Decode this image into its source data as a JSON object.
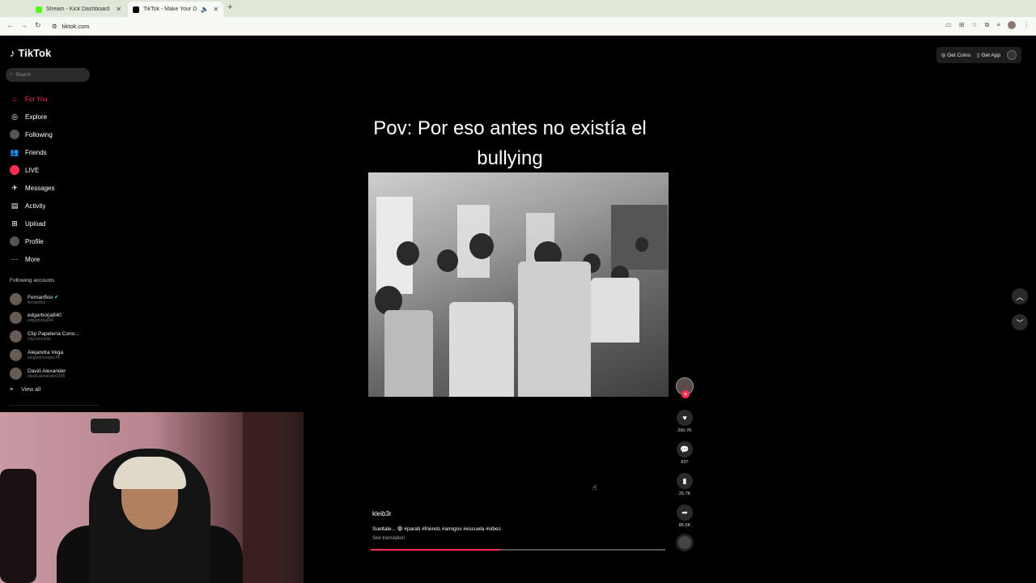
{
  "browser": {
    "tabs": [
      {
        "title": "Stream - Kick Dashboard",
        "active": false,
        "favicon_color": "#53fc18"
      },
      {
        "title": "TikTok - Make Your Day",
        "active": true,
        "favicon_color": "#000000"
      }
    ],
    "url": "tiktok.com"
  },
  "app": {
    "logo": "TikTok",
    "search_placeholder": "Search"
  },
  "nav": [
    {
      "label": "For You",
      "icon": "home-icon",
      "active": true
    },
    {
      "label": "Explore",
      "icon": "compass-icon",
      "active": false
    },
    {
      "label": "Following",
      "icon": "avatar-icon",
      "active": false
    },
    {
      "label": "Friends",
      "icon": "people-icon",
      "active": false
    },
    {
      "label": "LIVE",
      "icon": "live-icon",
      "active": false
    },
    {
      "label": "Messages",
      "icon": "messages-icon",
      "active": false
    },
    {
      "label": "Activity",
      "icon": "activity-icon",
      "active": false
    },
    {
      "label": "Upload",
      "icon": "upload-icon",
      "active": false
    },
    {
      "label": "Profile",
      "icon": "profile-icon",
      "active": false
    },
    {
      "label": "More",
      "icon": "more-icon",
      "active": false
    }
  ],
  "following_accounts": {
    "title": "Following accounts",
    "accounts": [
      {
        "name": "Fernanfloo",
        "handle": "fernanfloo",
        "verified": true
      },
      {
        "name": "edgarborja840",
        "handle": "edgarborja840",
        "verified": false
      },
      {
        "name": "Clip Papelería Cono...",
        "handle": "clip.conocoto",
        "verified": false
      },
      {
        "name": "Alejandra Vega",
        "handle": "alejandravega144",
        "verified": false
      },
      {
        "name": "David Alexander",
        "handle": "david.alexander1045",
        "verified": false
      }
    ],
    "view_all": "View all"
  },
  "topbar": {
    "get_coins": "Get Coins",
    "get_app": "Get App"
  },
  "video": {
    "caption": "Pov: Por eso antes no existía el bullying",
    "username": "kleib3r",
    "description": "Sueltale... 😁 #parati #friends #amigos #escuela #vibes",
    "see_translation": "See translation",
    "progress": 0.44,
    "likes": "260.7K",
    "comments": "837",
    "saves": "25.7K",
    "shares": "86.6K"
  }
}
